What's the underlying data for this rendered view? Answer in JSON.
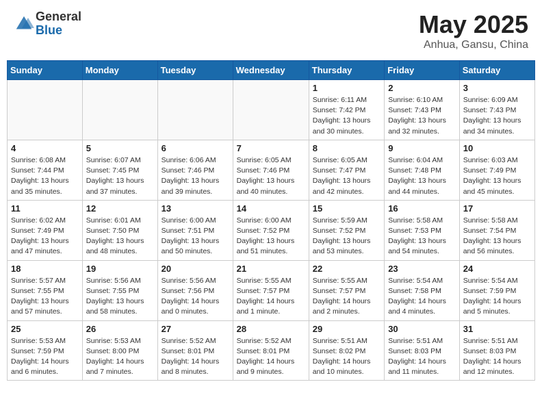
{
  "header": {
    "logo_general": "General",
    "logo_blue": "Blue",
    "month": "May 2025",
    "location": "Anhua, Gansu, China"
  },
  "weekdays": [
    "Sunday",
    "Monday",
    "Tuesday",
    "Wednesday",
    "Thursday",
    "Friday",
    "Saturday"
  ],
  "weeks": [
    [
      {
        "day": "",
        "detail": ""
      },
      {
        "day": "",
        "detail": ""
      },
      {
        "day": "",
        "detail": ""
      },
      {
        "day": "",
        "detail": ""
      },
      {
        "day": "1",
        "detail": "Sunrise: 6:11 AM\nSunset: 7:42 PM\nDaylight: 13 hours\nand 30 minutes."
      },
      {
        "day": "2",
        "detail": "Sunrise: 6:10 AM\nSunset: 7:43 PM\nDaylight: 13 hours\nand 32 minutes."
      },
      {
        "day": "3",
        "detail": "Sunrise: 6:09 AM\nSunset: 7:43 PM\nDaylight: 13 hours\nand 34 minutes."
      }
    ],
    [
      {
        "day": "4",
        "detail": "Sunrise: 6:08 AM\nSunset: 7:44 PM\nDaylight: 13 hours\nand 35 minutes."
      },
      {
        "day": "5",
        "detail": "Sunrise: 6:07 AM\nSunset: 7:45 PM\nDaylight: 13 hours\nand 37 minutes."
      },
      {
        "day": "6",
        "detail": "Sunrise: 6:06 AM\nSunset: 7:46 PM\nDaylight: 13 hours\nand 39 minutes."
      },
      {
        "day": "7",
        "detail": "Sunrise: 6:05 AM\nSunset: 7:46 PM\nDaylight: 13 hours\nand 40 minutes."
      },
      {
        "day": "8",
        "detail": "Sunrise: 6:05 AM\nSunset: 7:47 PM\nDaylight: 13 hours\nand 42 minutes."
      },
      {
        "day": "9",
        "detail": "Sunrise: 6:04 AM\nSunset: 7:48 PM\nDaylight: 13 hours\nand 44 minutes."
      },
      {
        "day": "10",
        "detail": "Sunrise: 6:03 AM\nSunset: 7:49 PM\nDaylight: 13 hours\nand 45 minutes."
      }
    ],
    [
      {
        "day": "11",
        "detail": "Sunrise: 6:02 AM\nSunset: 7:49 PM\nDaylight: 13 hours\nand 47 minutes."
      },
      {
        "day": "12",
        "detail": "Sunrise: 6:01 AM\nSunset: 7:50 PM\nDaylight: 13 hours\nand 48 minutes."
      },
      {
        "day": "13",
        "detail": "Sunrise: 6:00 AM\nSunset: 7:51 PM\nDaylight: 13 hours\nand 50 minutes."
      },
      {
        "day": "14",
        "detail": "Sunrise: 6:00 AM\nSunset: 7:52 PM\nDaylight: 13 hours\nand 51 minutes."
      },
      {
        "day": "15",
        "detail": "Sunrise: 5:59 AM\nSunset: 7:52 PM\nDaylight: 13 hours\nand 53 minutes."
      },
      {
        "day": "16",
        "detail": "Sunrise: 5:58 AM\nSunset: 7:53 PM\nDaylight: 13 hours\nand 54 minutes."
      },
      {
        "day": "17",
        "detail": "Sunrise: 5:58 AM\nSunset: 7:54 PM\nDaylight: 13 hours\nand 56 minutes."
      }
    ],
    [
      {
        "day": "18",
        "detail": "Sunrise: 5:57 AM\nSunset: 7:55 PM\nDaylight: 13 hours\nand 57 minutes."
      },
      {
        "day": "19",
        "detail": "Sunrise: 5:56 AM\nSunset: 7:55 PM\nDaylight: 13 hours\nand 58 minutes."
      },
      {
        "day": "20",
        "detail": "Sunrise: 5:56 AM\nSunset: 7:56 PM\nDaylight: 14 hours\nand 0 minutes."
      },
      {
        "day": "21",
        "detail": "Sunrise: 5:55 AM\nSunset: 7:57 PM\nDaylight: 14 hours\nand 1 minute."
      },
      {
        "day": "22",
        "detail": "Sunrise: 5:55 AM\nSunset: 7:57 PM\nDaylight: 14 hours\nand 2 minutes."
      },
      {
        "day": "23",
        "detail": "Sunrise: 5:54 AM\nSunset: 7:58 PM\nDaylight: 14 hours\nand 4 minutes."
      },
      {
        "day": "24",
        "detail": "Sunrise: 5:54 AM\nSunset: 7:59 PM\nDaylight: 14 hours\nand 5 minutes."
      }
    ],
    [
      {
        "day": "25",
        "detail": "Sunrise: 5:53 AM\nSunset: 7:59 PM\nDaylight: 14 hours\nand 6 minutes."
      },
      {
        "day": "26",
        "detail": "Sunrise: 5:53 AM\nSunset: 8:00 PM\nDaylight: 14 hours\nand 7 minutes."
      },
      {
        "day": "27",
        "detail": "Sunrise: 5:52 AM\nSunset: 8:01 PM\nDaylight: 14 hours\nand 8 minutes."
      },
      {
        "day": "28",
        "detail": "Sunrise: 5:52 AM\nSunset: 8:01 PM\nDaylight: 14 hours\nand 9 minutes."
      },
      {
        "day": "29",
        "detail": "Sunrise: 5:51 AM\nSunset: 8:02 PM\nDaylight: 14 hours\nand 10 minutes."
      },
      {
        "day": "30",
        "detail": "Sunrise: 5:51 AM\nSunset: 8:03 PM\nDaylight: 14 hours\nand 11 minutes."
      },
      {
        "day": "31",
        "detail": "Sunrise: 5:51 AM\nSunset: 8:03 PM\nDaylight: 14 hours\nand 12 minutes."
      }
    ]
  ]
}
